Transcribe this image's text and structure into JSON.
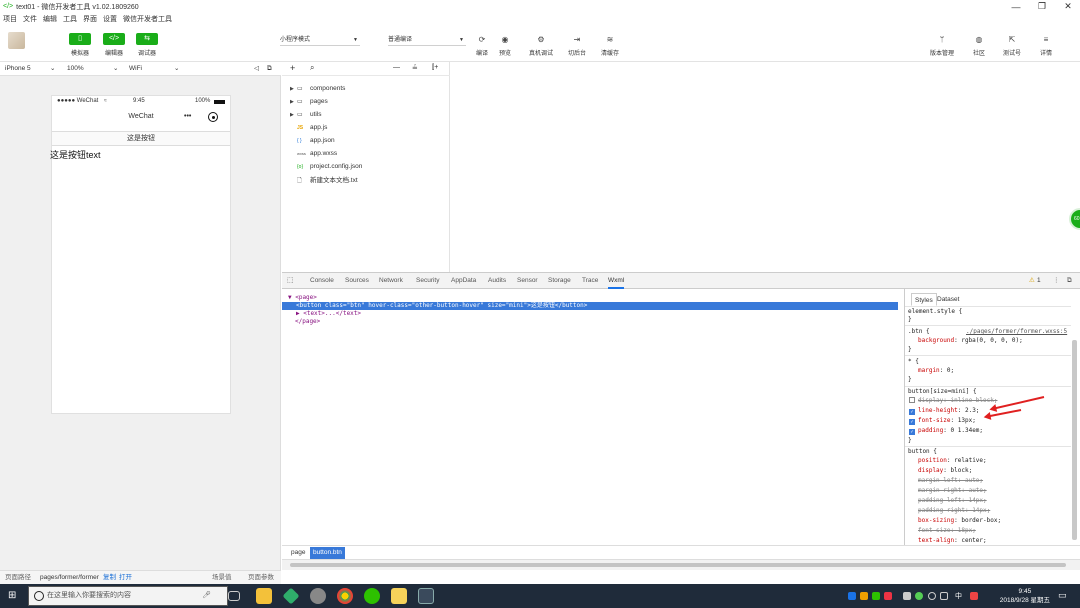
{
  "window": {
    "title": "text01 - 微信开发者工具 v1.02.1809260",
    "controls": [
      "—",
      "❐",
      "✕"
    ]
  },
  "menu": [
    "项目",
    "文件",
    "编辑",
    "工具",
    "界面",
    "设置",
    "微信开发者工具"
  ],
  "toolbar": {
    "modes": [
      {
        "label": "模拟器",
        "icon": "▯"
      },
      {
        "label": "编辑器",
        "icon": "</>"
      },
      {
        "label": "调试器",
        "icon": "⇆"
      }
    ],
    "mode_select": "小程序模式",
    "compile_select": "普通编译",
    "actions": [
      {
        "label": "编译",
        "icon": "⟳"
      },
      {
        "label": "预览",
        "icon": "◉"
      },
      {
        "label": "真机调试",
        "icon": "⚙"
      },
      {
        "label": "切后台",
        "icon": "⇥"
      },
      {
        "label": "清缓存",
        "icon": "≋"
      }
    ],
    "right_actions": [
      {
        "label": "版本管理",
        "icon": "ᛘ"
      },
      {
        "label": "社区",
        "icon": "◍"
      },
      {
        "label": "测试号",
        "icon": "⇱"
      },
      {
        "label": "详情",
        "icon": "≡"
      }
    ]
  },
  "simulator": {
    "device": "iPhone 5",
    "zoom": "100%",
    "network": "WiFi",
    "status_left": "●●●●● WeChat",
    "status_time": "9:45",
    "status_battery": "100%",
    "nav_title": "WeChat",
    "nav_dots": "•••",
    "button_text": "这是按钮",
    "page_text": "这是按钮text"
  },
  "sim_footer": {
    "path_label": "页面路径",
    "path": "pages/former/former",
    "copy": "复制",
    "open": "打开",
    "scene": "场景值",
    "params": "页面参数"
  },
  "file_toolbar": {
    "add": "+",
    "search": "⌕",
    "collapse": "—",
    "sort": "≟",
    "split": "⫿+"
  },
  "files": [
    {
      "name": "components",
      "type": "folder",
      "icon": "▭"
    },
    {
      "name": "pages",
      "type": "folder",
      "icon": "▭"
    },
    {
      "name": "utils",
      "type": "folder",
      "icon": "▭"
    },
    {
      "name": "app.js",
      "type": "js",
      "icon": "JS"
    },
    {
      "name": "app.json",
      "type": "json",
      "icon": "{ }"
    },
    {
      "name": "app.wxss",
      "type": "wxss",
      "icon": "wxss"
    },
    {
      "name": "project.config.json",
      "type": "json",
      "icon": "{o}"
    },
    {
      "name": "新建文本文档.txt",
      "type": "txt",
      "icon": "🗋"
    }
  ],
  "devtools": {
    "tabs": [
      "Console",
      "Sources",
      "Network",
      "Security",
      "AppData",
      "Audits",
      "Sensor",
      "Storage",
      "Trace",
      "Wxml"
    ],
    "active_tab": "Wxml",
    "warning_count": "1",
    "wxml": {
      "page_open": "▼ <page>",
      "sel_tag": "<button",
      "a1": " class=",
      "v1": "\"btn\"",
      "a2": " hover-class=",
      "v2": "\"other-button-hover\"",
      "a3": " size=",
      "v3": "\"mini\"",
      "sel_close": ">这是按钮</button>",
      "text_line": "▶ <text>...</text>",
      "page_close": "</page>"
    },
    "styles_tabs": [
      "Styles",
      "Dataset"
    ],
    "styles": {
      "element_style": "element.style {",
      "brace_close": "}",
      "btn_sel": ".btn {",
      "btn_src": "./pages/former/former.wxss:5",
      "btn_bg_name": "background",
      "btn_bg_val": ": rgba(0, 0, 0, 0);",
      "star_sel": "* {",
      "star_margin_name": "margin",
      "star_margin_val": ": 0;",
      "mini_sel": "button[size=mini] {",
      "mini_props": [
        {
          "name": "display",
          "value": ": inline-block;",
          "checked": false
        },
        {
          "name": "line-height",
          "value": ": 2.3;",
          "checked": true
        },
        {
          "name": "font-size",
          "value": ": 13px;",
          "checked": true
        },
        {
          "name": "padding",
          "value": ": 0 1.34em;",
          "checked": true
        }
      ],
      "button_sel": "button {",
      "button_props": [
        {
          "name": "position",
          "value": ": relative;"
        },
        {
          "name": "display",
          "value": ": block;"
        },
        {
          "name": "margin-left",
          "value": ": auto;"
        },
        {
          "name": "margin-right",
          "value": ": auto;"
        },
        {
          "name": "padding-left",
          "value": ": 14px;"
        },
        {
          "name": "padding-right",
          "value": ": 14px;"
        },
        {
          "name": "box-sizing",
          "value": ": border-box;"
        },
        {
          "name": "font-size",
          "value": ": 18px;"
        },
        {
          "name": "text-align",
          "value": ": center;"
        }
      ]
    },
    "breadcrumb": [
      "page",
      "button.btn"
    ]
  },
  "taskbar": {
    "search_placeholder": "在这里输入你要搜索的内容",
    "time": "9:45",
    "date": "2018/9/28 星期五",
    "ime": "中"
  },
  "colors": {
    "accent": "#1aad19",
    "selection": "#3879d9",
    "annotation": "#e02020"
  }
}
